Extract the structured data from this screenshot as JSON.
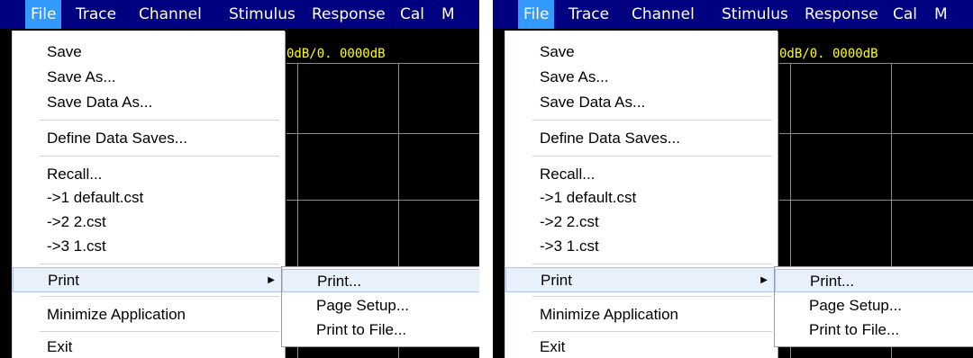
{
  "menubar": {
    "items": [
      "File",
      "Trace",
      "Channel",
      "Stimulus",
      "Response",
      "Cal",
      "M"
    ]
  },
  "display": {
    "scale_readout": "0dB/0. 0000dB"
  },
  "file_menu": {
    "items": {
      "save": "Save",
      "save_as": "Save As...",
      "save_data_as": "Save Data As...",
      "define_data_saves": "Define Data Saves...",
      "recall": "Recall...",
      "recent_1": "->1 default.cst",
      "recent_2": "->2 2.cst",
      "recent_3": "->3 1.cst",
      "print": "Print",
      "minimize": "Minimize Application",
      "exit": "Exit"
    }
  },
  "print_submenu": {
    "items": {
      "print": "Print...",
      "page_setup": "Page Setup...",
      "print_to_file": "Print to File..."
    }
  },
  "colors": {
    "menubar_bg": "#000080",
    "active_menu": "#3399ff",
    "scale_text": "#ffff00",
    "highlight_bg": "#e8f1fb"
  }
}
